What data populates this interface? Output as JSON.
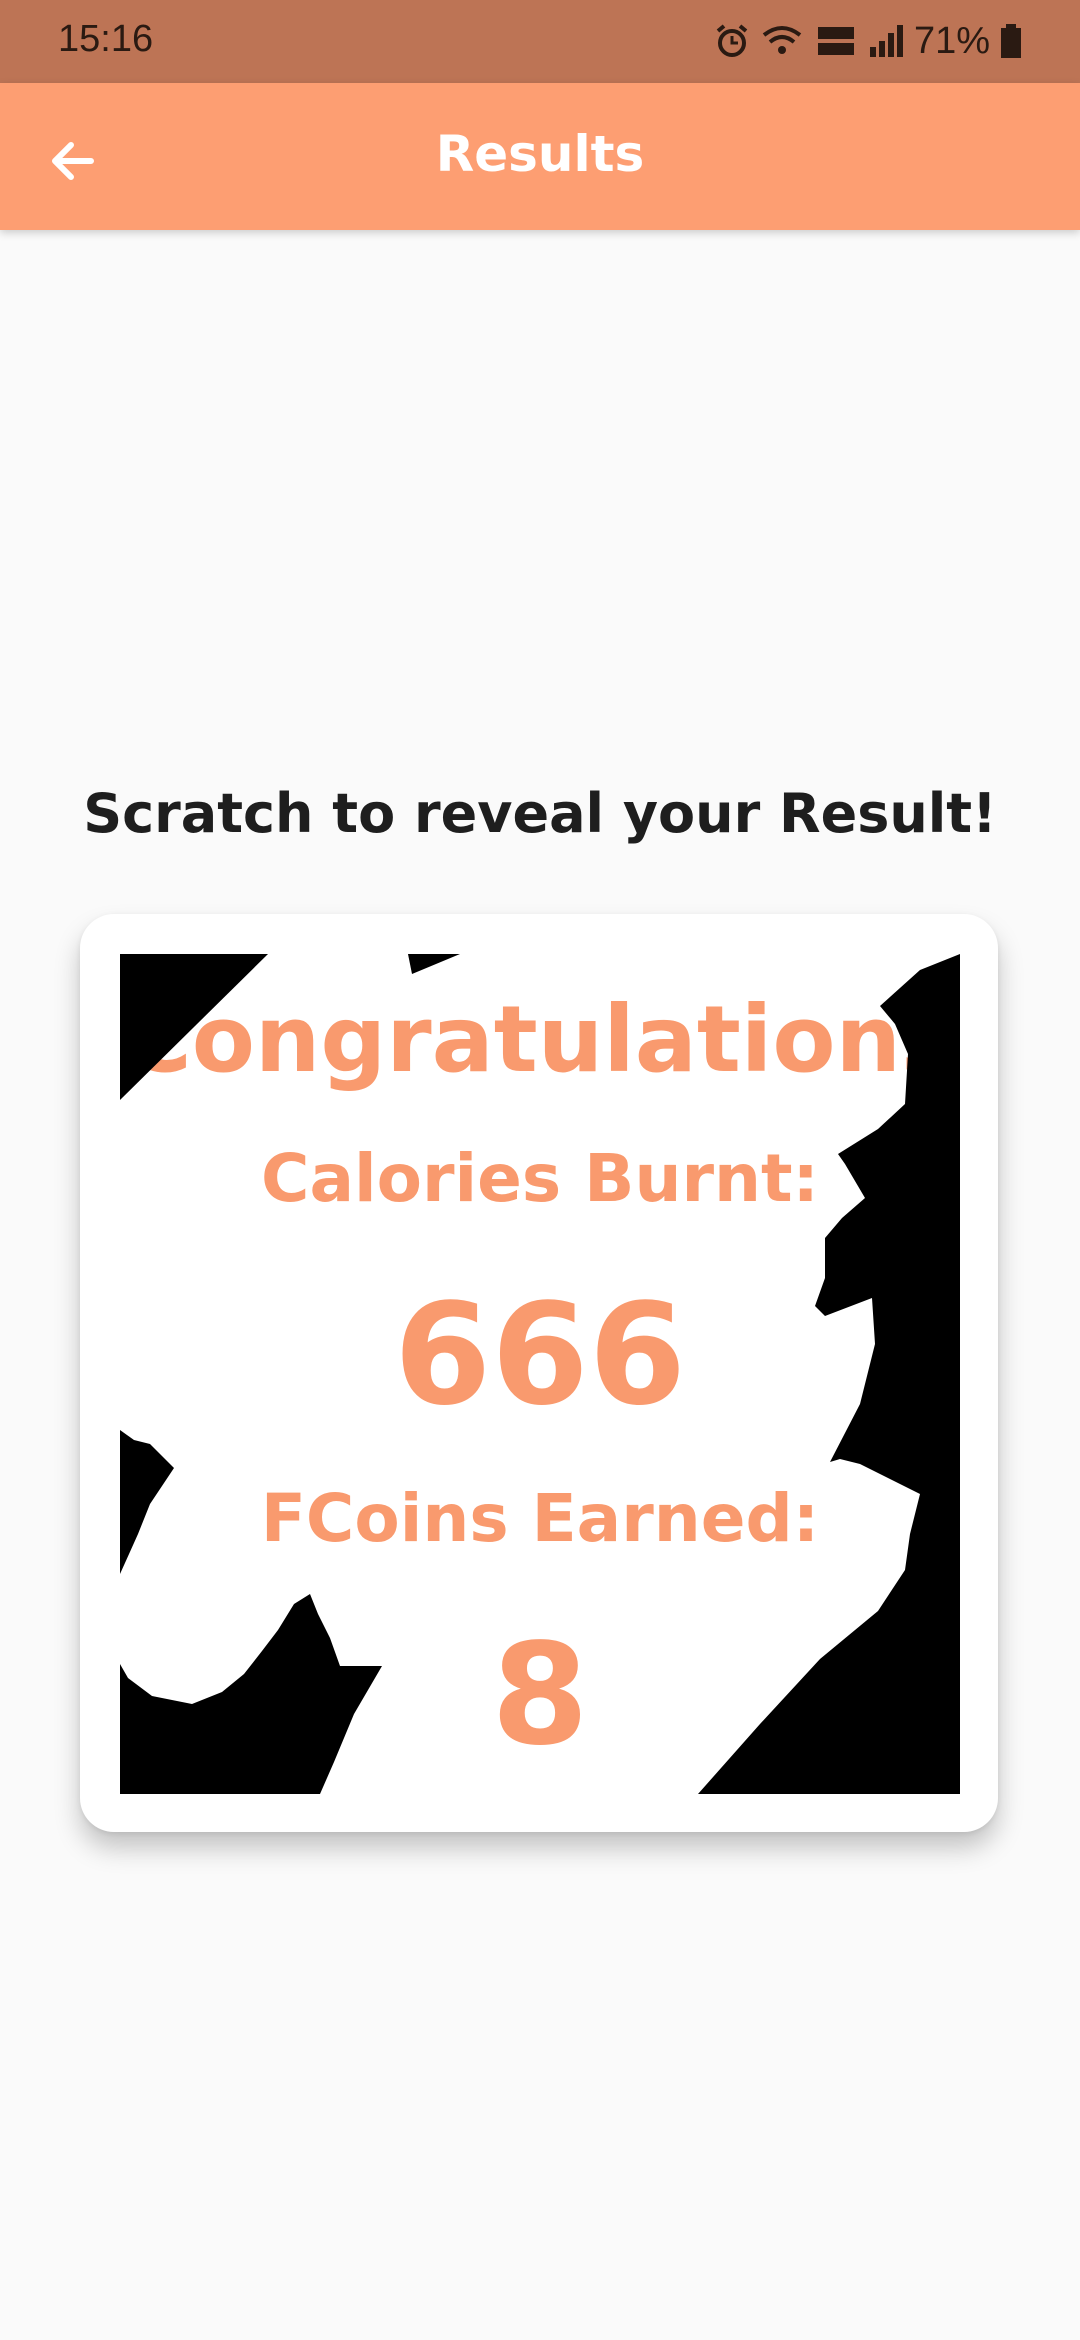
{
  "status_bar": {
    "time": "15:16",
    "battery": "71%",
    "icons": [
      "alarm-icon",
      "wifi-icon",
      "volte-lte-icon",
      "signal-icon",
      "battery-icon"
    ]
  },
  "app_bar": {
    "title": "Results",
    "back_icon": "arrow-left-icon",
    "color": "#fd9e72"
  },
  "prompt": "Scratch to reveal your Result!",
  "result_card": {
    "title": "Congratulations",
    "calories_label": "Calories Burnt:",
    "calories_value": "666",
    "coins_label": "FCoins Earned:",
    "coins_value": "8",
    "accent_color": "#f99a6e",
    "scratch_color": "#000000"
  }
}
